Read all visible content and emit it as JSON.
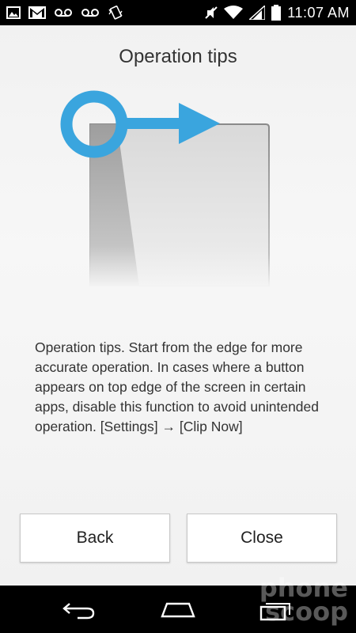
{
  "status_bar": {
    "time": "11:07 AM",
    "left_icons": [
      "image-icon",
      "gmail-icon",
      "voicemail-icon",
      "voicemail-icon",
      "vibrate-icon"
    ],
    "right_icons": [
      "mute-icon",
      "wifi-icon",
      "signal-icon",
      "battery-icon"
    ]
  },
  "dialog": {
    "title": "Operation tips",
    "body": "Operation tips. Start from the edge for more accurate operation. In cases where a button appears on top edge of the screen in certain apps, disable this function to avoid unintended operation. [Settings] → [Clip Now]",
    "back_label": "Back",
    "close_label": "Close"
  },
  "illustration": {
    "accent_color": "#3aa5de",
    "icons": [
      "touch-circle-icon",
      "arrow-right-icon"
    ]
  },
  "nav_bar": {
    "icons": [
      "back-icon",
      "home-icon",
      "recent-apps-icon"
    ]
  },
  "watermark": {
    "line1": "phone",
    "line2": "scoop"
  }
}
